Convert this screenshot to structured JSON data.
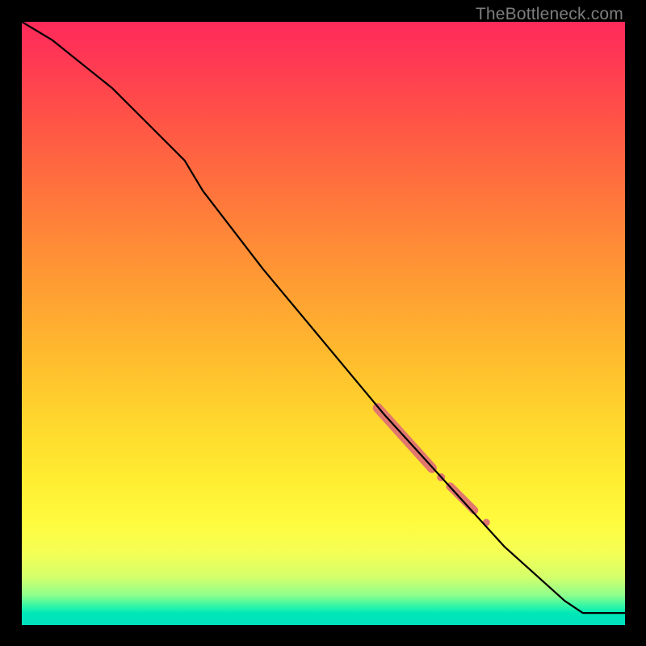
{
  "attribution": "TheBottleneck.com",
  "colors": {
    "segment": "#e2776e",
    "curve": "#000000"
  },
  "chart_data": {
    "type": "line",
    "title": "",
    "xlabel": "",
    "ylabel": "",
    "xlim": [
      0,
      100
    ],
    "ylim": [
      0,
      100
    ],
    "grid": false,
    "legend": false,
    "background": "red-yellow-green vertical gradient",
    "series": [
      {
        "name": "curve",
        "x": [
          0,
          5,
          10,
          15,
          20,
          25,
          27,
          30,
          40,
          50,
          60,
          70,
          80,
          90,
          93,
          95,
          100
        ],
        "y": [
          100,
          97,
          93,
          89,
          84,
          79,
          77,
          72,
          59,
          47,
          35,
          24,
          13,
          4,
          2,
          2,
          2
        ]
      }
    ],
    "highlights": {
      "thick_segments": [
        {
          "x_start": 59,
          "y_start": 36,
          "x_end": 68,
          "y_end": 26,
          "width": 12
        },
        {
          "x_start": 71,
          "y_start": 23,
          "x_end": 75,
          "y_end": 19,
          "width": 10
        }
      ],
      "dots": [
        {
          "x": 69.5,
          "y": 24.5,
          "r": 5
        },
        {
          "x": 77,
          "y": 17,
          "r": 4.5
        }
      ]
    }
  }
}
